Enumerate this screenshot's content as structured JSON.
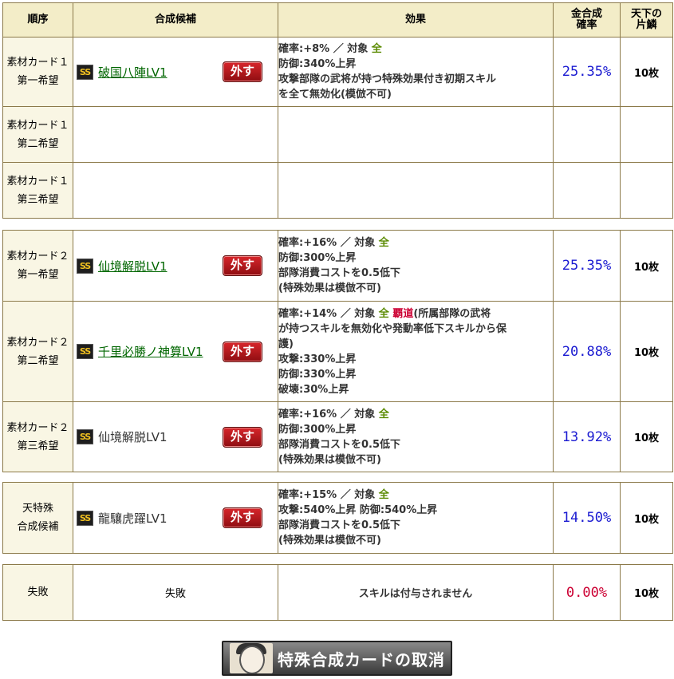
{
  "headers": {
    "order": "順序",
    "candidate": "合成候補",
    "effect": "効果",
    "rate": "金合成\n確率",
    "count": "天下の\n片鱗"
  },
  "remove_label": "外す",
  "badge": "SS",
  "groups": [
    {
      "rows": [
        {
          "order1": "素材カード１",
          "order2": "第一希望",
          "card": "破国八陣LV1",
          "link": true,
          "effect": [
            {
              "pre": "確率:+8% ／ 対象 ",
              "all": "全"
            },
            {
              "text": "防御:340%上昇"
            },
            {
              "text": "攻撃部隊の武将が持つ特殊効果付き初期スキル"
            },
            {
              "text": "を全て無効化(模倣不可)"
            }
          ],
          "rate": "25.35%",
          "count": "10枚"
        },
        {
          "order1": "素材カード１",
          "order2": "第二希望"
        },
        {
          "order1": "素材カード１",
          "order2": "第三希望"
        }
      ]
    },
    {
      "rows": [
        {
          "order1": "素材カード２",
          "order2": "第一希望",
          "card": "仙境解脱LV1",
          "link": true,
          "effect": [
            {
              "pre": "確率:+16% ／ 対象 ",
              "all": "全"
            },
            {
              "text": "防御:300%上昇"
            },
            {
              "text": "部隊消費コストを0.5低下"
            },
            {
              "text": "(特殊効果は模倣不可)"
            }
          ],
          "rate": "25.35%",
          "count": "10枚"
        },
        {
          "order1": "素材カード２",
          "order2": "第二希望",
          "card": "千里必勝ノ神算LV1",
          "link": true,
          "effect": [
            {
              "pre": "確率:+14% ／ 対象 ",
              "all": "全",
              "badou": "覇道",
              "post": "(所属部隊の武将"
            },
            {
              "text": "が持つスキルを無効化や発動率低下スキルから保"
            },
            {
              "text": "護)"
            },
            {
              "text": "攻撃:330%上昇"
            },
            {
              "text": "防御:330%上昇"
            },
            {
              "text": "破壊:30%上昇"
            }
          ],
          "rate": "20.88%",
          "count": "10枚"
        },
        {
          "order1": "素材カード２",
          "order2": "第三希望",
          "card": "仙境解脱LV1",
          "link": false,
          "effect": [
            {
              "pre": "確率:+16% ／ 対象 ",
              "all": "全"
            },
            {
              "text": "防御:300%上昇"
            },
            {
              "text": "部隊消費コストを0.5低下"
            },
            {
              "text": "(特殊効果は模倣不可)"
            }
          ],
          "rate": "13.92%",
          "count": "10枚"
        }
      ]
    },
    {
      "rows": [
        {
          "order1": "天特殊",
          "order2": "合成候補",
          "card": "龍驤虎躍LV1",
          "link": false,
          "effect": [
            {
              "pre": "確率:+15% ／ 対象 ",
              "all": "全"
            },
            {
              "text": "攻撃:540%上昇 防御:540%上昇"
            },
            {
              "text": "部隊消費コストを0.5低下"
            },
            {
              "text": "(特殊効果は模倣不可)"
            }
          ],
          "rate": "14.50%",
          "count": "10枚"
        }
      ]
    }
  ],
  "fail": {
    "order": "失敗",
    "candidate": "失敗",
    "effect": "スキルは付与されません",
    "rate": "0.00%",
    "count": "10枚"
  },
  "cancel_button": "特殊合成カードの取消",
  "colors": {
    "header_bg": "#f3edc8",
    "order_bg": "#f9f6e4",
    "border": "#8c7a4a",
    "rate": "#1a1ad1",
    "fail_rate": "#cc0033",
    "link": "#006600",
    "all": "#5a8a00"
  }
}
